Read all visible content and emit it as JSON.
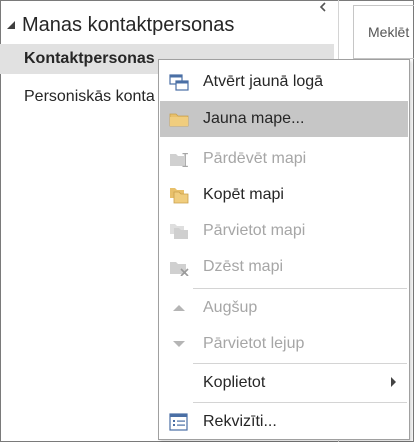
{
  "nav": {
    "header": "Manas kontaktpersonas",
    "items": [
      {
        "label": "Kontaktpersonas",
        "selected": true
      },
      {
        "label": "Personiskās konta",
        "selected": false
      }
    ]
  },
  "search": {
    "placeholder": "Meklēt"
  },
  "menu": {
    "items": [
      {
        "label": "Atvērt jaunā logā",
        "icon": "new-window-icon",
        "enabled": true
      },
      {
        "label": "Jauna mape...",
        "icon": "folder-icon",
        "enabled": true,
        "highlighted": true
      },
      {
        "label": "Pārdēvēt mapi",
        "icon": "rename-folder-icon",
        "enabled": false
      },
      {
        "label": "Kopēt mapi",
        "icon": "copy-folder-icon",
        "enabled": true
      },
      {
        "label": "Pārvietot mapi",
        "icon": "move-folder-icon",
        "enabled": false
      },
      {
        "label": "Dzēst mapi",
        "icon": "delete-folder-icon",
        "enabled": false
      },
      {
        "label": "Augšup",
        "icon": "up-arrow-icon",
        "enabled": false
      },
      {
        "label": "Pārvietot lejup",
        "icon": "down-arrow-icon",
        "enabled": false
      },
      {
        "label": "Koplietot",
        "icon": "",
        "enabled": true,
        "submenu": true
      },
      {
        "label": "Rekvizīti...",
        "icon": "properties-icon",
        "enabled": true
      }
    ]
  },
  "colors": {
    "folder": "#e8c06b",
    "highlight": "#c6c6c6",
    "selected": "#e1e1e1",
    "disabled": "#a6a6a6"
  }
}
